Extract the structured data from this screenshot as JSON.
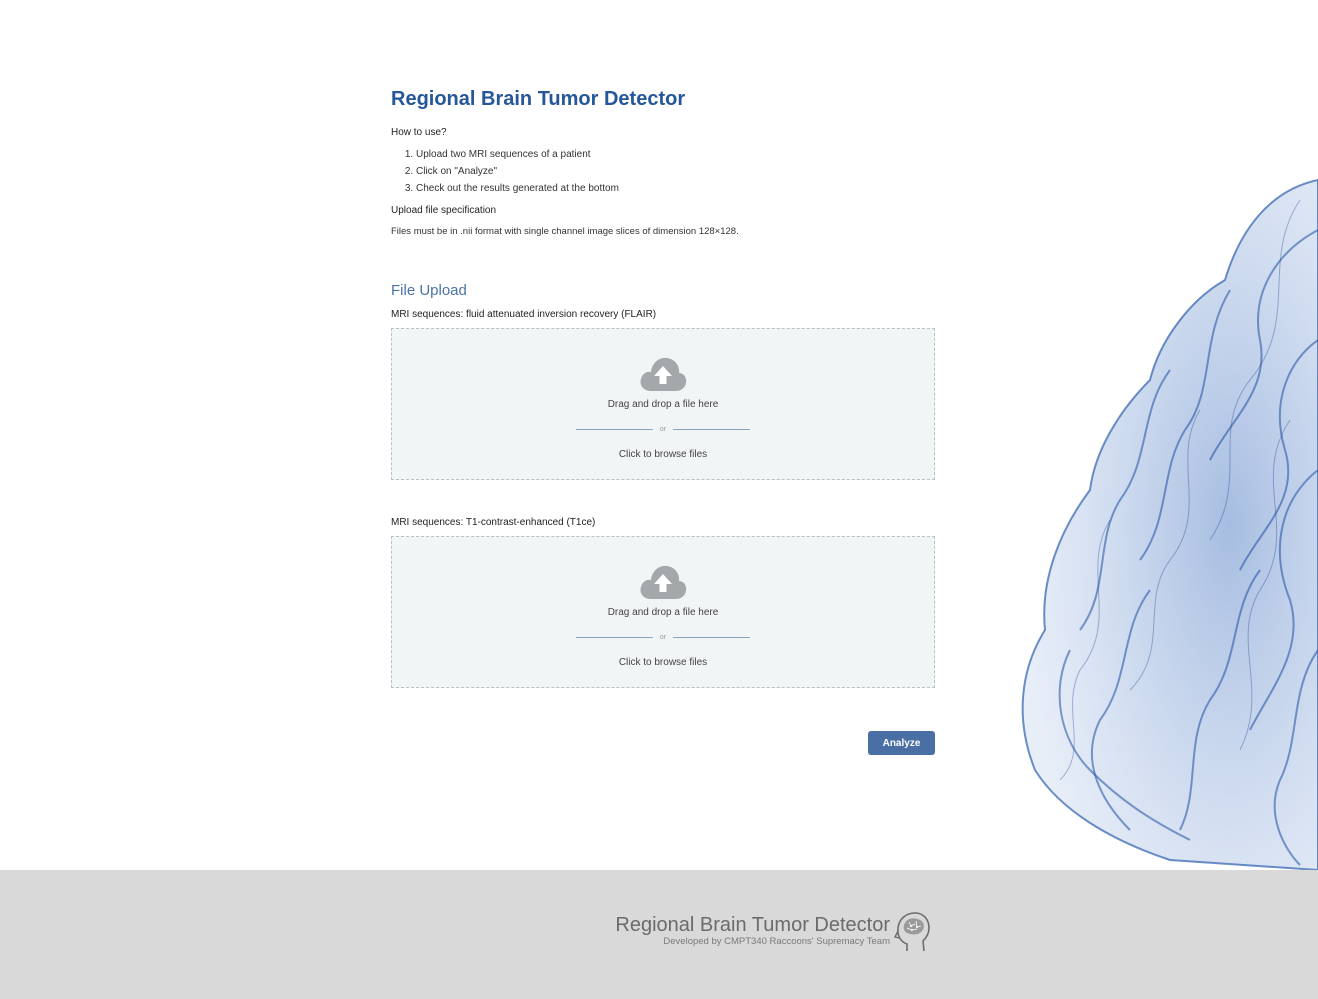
{
  "app": {
    "title": "Regional Brain Tumor Detector"
  },
  "instructions": {
    "how_to_use_label": "How to use?",
    "steps": [
      "Upload two MRI sequences of a patient",
      "Click on \"Analyze\"",
      "Check out the results generated at the bottom"
    ],
    "spec_label": "Upload file specification",
    "spec_text": "Files must be in .nii format with single channel image slices of dimension 128×128."
  },
  "upload": {
    "section_title": "File Upload",
    "fields": [
      {
        "label": "MRI sequences: fluid attenuated inversion recovery (FLAIR)",
        "drag_text": "Drag and drop a file here",
        "or_text": "or",
        "browse_text": "Click to browse files",
        "icon": "cloud-upload-icon"
      },
      {
        "label": "MRI sequences: T1-contrast-enhanced (T1ce)",
        "drag_text": "Drag and drop a file here",
        "or_text": "or",
        "browse_text": "Click to browse files",
        "icon": "cloud-upload-icon"
      }
    ],
    "analyze_label": "Analyze"
  },
  "footer": {
    "title": "Regional Brain Tumor Detector",
    "subtitle": "Developed by CMPT340 Raccoons' Supremacy Team",
    "logo_icon": "head-brain-icon"
  },
  "colors": {
    "accent": "#25579a",
    "button": "#4a6fa5",
    "dropzone_bg": "#f1f5f6",
    "footer_bg": "#d9d9d9"
  }
}
